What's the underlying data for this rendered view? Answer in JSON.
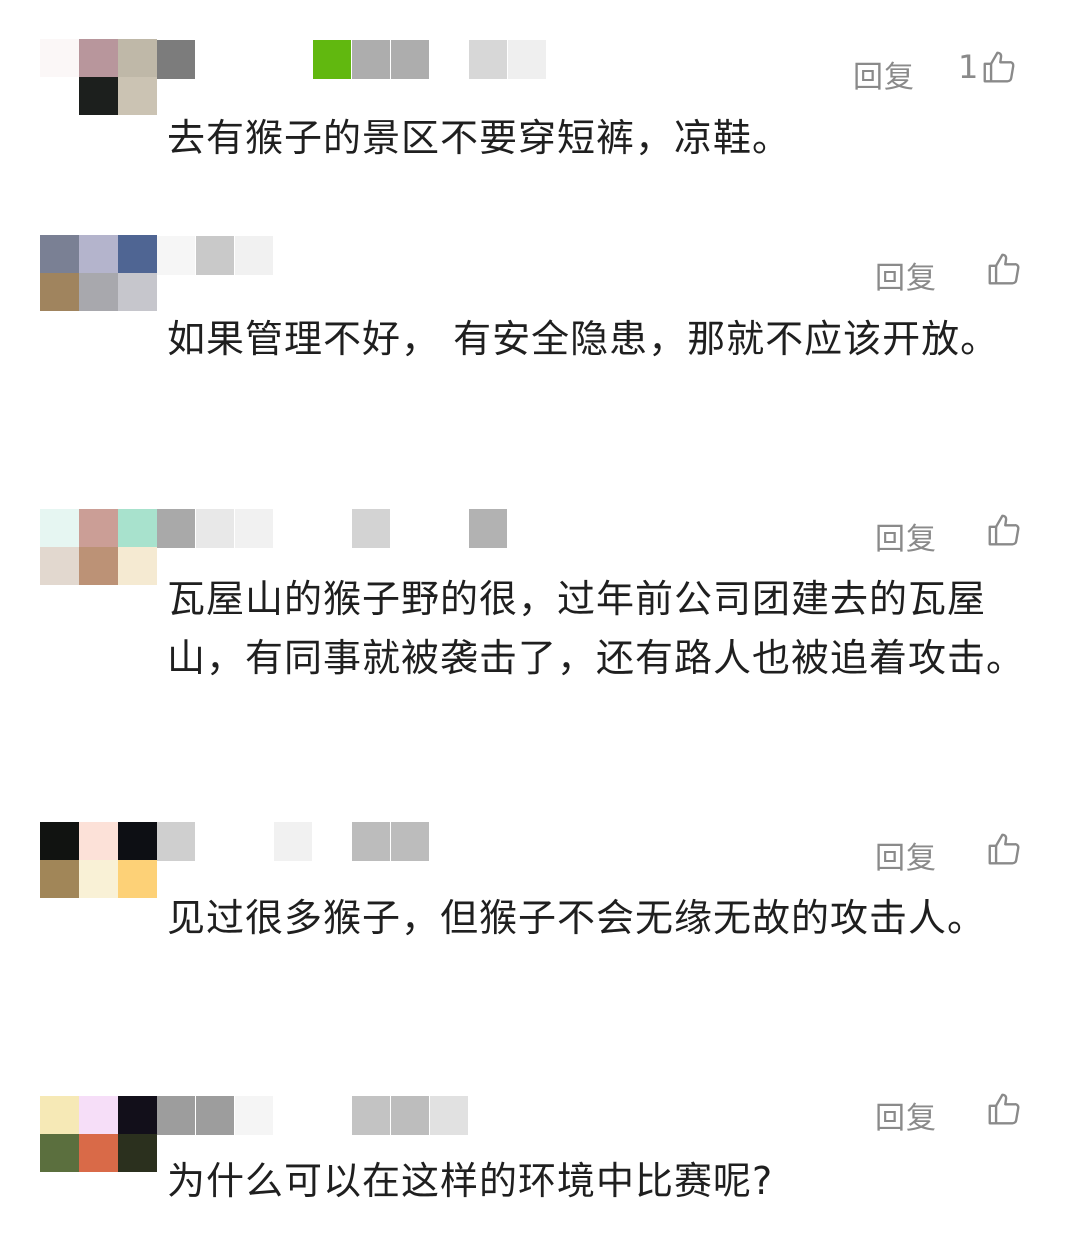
{
  "reply_label": "回复",
  "like_icon": "thumbs-up-icon",
  "colors": {
    "meta_gray": "#8a8a8a",
    "text": "#1f1f1f",
    "background": "#ffffff"
  },
  "comments": [
    {
      "text": "去有猴子的景区不要穿短裤，凉鞋。",
      "likes": "1"
    },
    {
      "text": "如果管理不好， 有安全隐患，那就不应该开放。",
      "likes": ""
    },
    {
      "text": "瓦屋山的猴子野的很，过年前公司团建去的瓦屋山，有同事就被袭击了，还有路人也被追着攻击。",
      "likes": ""
    },
    {
      "text": "见过很多猴子，但猴子不会无缘无故的攻击人。",
      "likes": ""
    },
    {
      "text": "为什么可以在这样的环境中比赛呢?",
      "likes": ""
    }
  ]
}
